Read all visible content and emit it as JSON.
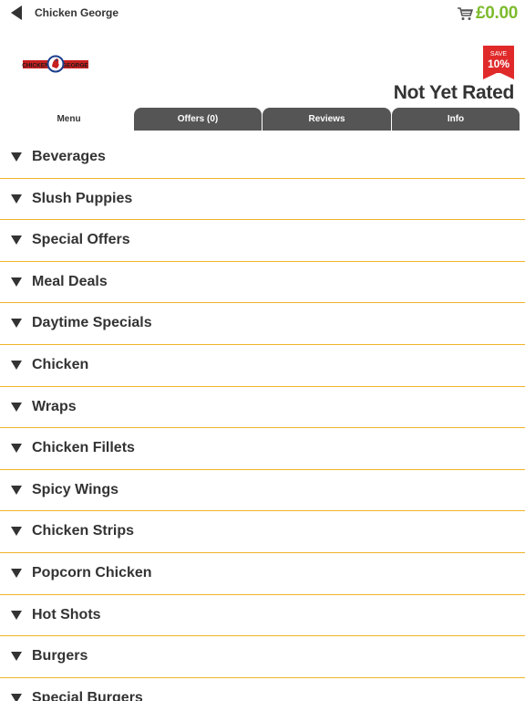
{
  "header": {
    "title": "Chicken George",
    "back_icon": "back-arrow-icon",
    "cart_icon": "cart-icon",
    "cart_total": "£0.00",
    "accent_color": "#7dbb2c"
  },
  "logo": {
    "text": "CHICKEN GEORGE"
  },
  "promo": {
    "small": "SAVE",
    "big": "10%",
    "color": "#e02a2a"
  },
  "rating": "Not Yet Rated",
  "tabs": [
    {
      "label": "Menu",
      "active": true
    },
    {
      "label": "Offers (0)",
      "active": false
    },
    {
      "label": "Reviews",
      "active": false
    },
    {
      "label": "Info",
      "active": false
    }
  ],
  "menu": {
    "items": [
      {
        "label": "Beverages"
      },
      {
        "label": "Slush Puppies"
      },
      {
        "label": "Special Offers"
      },
      {
        "label": "Meal Deals"
      },
      {
        "label": "Daytime Specials"
      },
      {
        "label": "Chicken"
      },
      {
        "label": "Wraps"
      },
      {
        "label": "Chicken Fillets"
      },
      {
        "label": "Spicy Wings"
      },
      {
        "label": "Chicken Strips"
      },
      {
        "label": "Popcorn Chicken"
      },
      {
        "label": "Hot Shots"
      },
      {
        "label": "Burgers"
      },
      {
        "label": "Special Burgers"
      }
    ],
    "divider_color": "#f0b428"
  }
}
